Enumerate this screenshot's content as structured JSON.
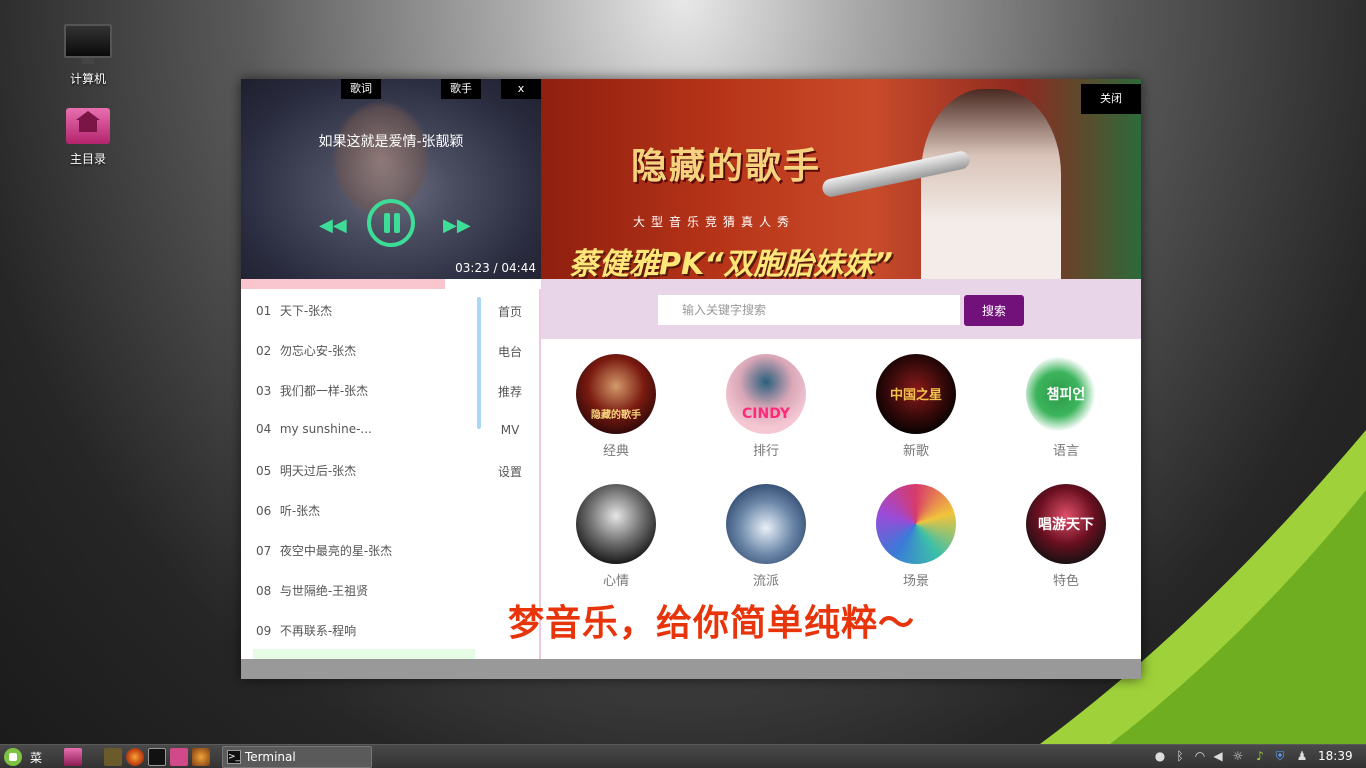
{
  "desktop": {
    "icons": [
      {
        "label": "计算机",
        "icon": "computer-icon"
      },
      {
        "label": "主目录",
        "icon": "home-folder-icon"
      }
    ]
  },
  "player": {
    "lyrics_btn": "歌词",
    "singer_btn": "歌手",
    "close_btn": "x",
    "song_title": "如果这就是爱情-张靓颖",
    "time": "03:23 / 04:44",
    "progress_fraction": 0.68,
    "accent_color": "#3ddc97"
  },
  "banner": {
    "show_logo": "隐藏的歌手",
    "show_sub": "大型音乐竞猜真人秀",
    "headline": "蔡健雅PK“双胞胎妹妹”",
    "close_btn": "关闭"
  },
  "playlist": {
    "items": [
      {
        "num": "01",
        "title": "天下-张杰"
      },
      {
        "num": "02",
        "title": "勿忘心安-张杰"
      },
      {
        "num": "03",
        "title": "我们都一样-张杰"
      },
      {
        "num": "04",
        "title": "my sunshine-..."
      },
      {
        "num": "05",
        "title": "明天过后-张杰"
      },
      {
        "num": "06",
        "title": "听-张杰"
      },
      {
        "num": "07",
        "title": "夜空中最亮的星-张杰"
      },
      {
        "num": "08",
        "title": "与世隔绝-王祖贤"
      },
      {
        "num": "09",
        "title": "不再联系-程响"
      }
    ]
  },
  "nav": {
    "items": [
      "首页",
      "电台",
      "推荐",
      "MV",
      "设置"
    ]
  },
  "search": {
    "placeholder": "输入关键字搜索",
    "button": "搜索",
    "button_color": "#72117a"
  },
  "categories": [
    {
      "label": "经典",
      "cover": "隐藏的歌手"
    },
    {
      "label": "排行",
      "cover": "CINDY"
    },
    {
      "label": "新歌",
      "cover": "中国之星"
    },
    {
      "label": "语言",
      "cover": "챔피언"
    },
    {
      "label": "心情",
      "cover": ""
    },
    {
      "label": "流派",
      "cover": ""
    },
    {
      "label": "场景",
      "cover": ""
    },
    {
      "label": "特色",
      "cover": "唱游天下"
    }
  ],
  "slogan": "梦音乐，给你简单纯粹～",
  "taskbar": {
    "menu_label": "菜单",
    "task_label": "Terminal",
    "clock": "18:39"
  }
}
